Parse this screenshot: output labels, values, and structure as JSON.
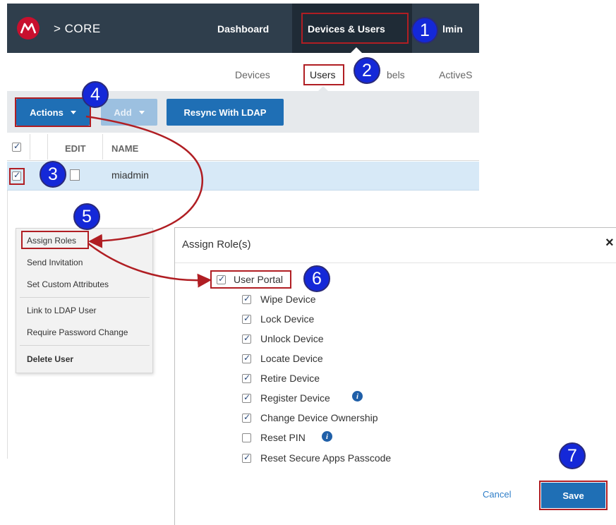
{
  "nav": {
    "brand": "> CORE",
    "items": [
      {
        "label": "Dashboard"
      },
      {
        "label": "Devices & Users"
      },
      {
        "label": "lmin"
      }
    ]
  },
  "subnav": {
    "items": [
      {
        "label": "Devices"
      },
      {
        "label": "Users"
      },
      {
        "label": "bels"
      },
      {
        "label": "ActiveS"
      }
    ]
  },
  "toolbar": {
    "actions_label": "Actions",
    "add_label": "Add",
    "resync_label": "Resync With LDAP"
  },
  "table": {
    "columns": [
      "EDIT",
      "NAME"
    ],
    "rows": [
      {
        "name": "miadmin",
        "checked": true
      }
    ]
  },
  "actions_menu": {
    "items": [
      {
        "label": "Assign Roles"
      },
      {
        "label": "Send Invitation"
      },
      {
        "label": "Set Custom Attributes"
      },
      {
        "label": "Link to LDAP User"
      },
      {
        "label": "Require Password Change"
      },
      {
        "label": "Delete User"
      }
    ]
  },
  "dialog": {
    "title": "Assign Role(s)",
    "close": "×",
    "parent_role": {
      "label": "User Portal",
      "checked": true
    },
    "permissions": [
      {
        "label": "Wipe Device",
        "checked": true
      },
      {
        "label": "Lock Device",
        "checked": true
      },
      {
        "label": "Unlock Device",
        "checked": true
      },
      {
        "label": "Locate Device",
        "checked": true
      },
      {
        "label": "Retire Device",
        "checked": true
      },
      {
        "label": "Register Device",
        "checked": true,
        "info": true
      },
      {
        "label": "Change Device Ownership",
        "checked": true
      },
      {
        "label": "Reset PIN",
        "checked": false,
        "info": true
      },
      {
        "label": "Reset Secure Apps Passcode",
        "checked": true
      }
    ],
    "cancel_label": "Cancel",
    "save_label": "Save"
  },
  "annotations": [
    "1",
    "2",
    "3",
    "4",
    "5",
    "6",
    "7"
  ],
  "colors": {
    "nav_bg": "#2f3e4c",
    "primary": "#1f6fb5",
    "highlight": "#b01e23",
    "badge": "#1428d8",
    "selected_row": "#d7e9f7"
  }
}
